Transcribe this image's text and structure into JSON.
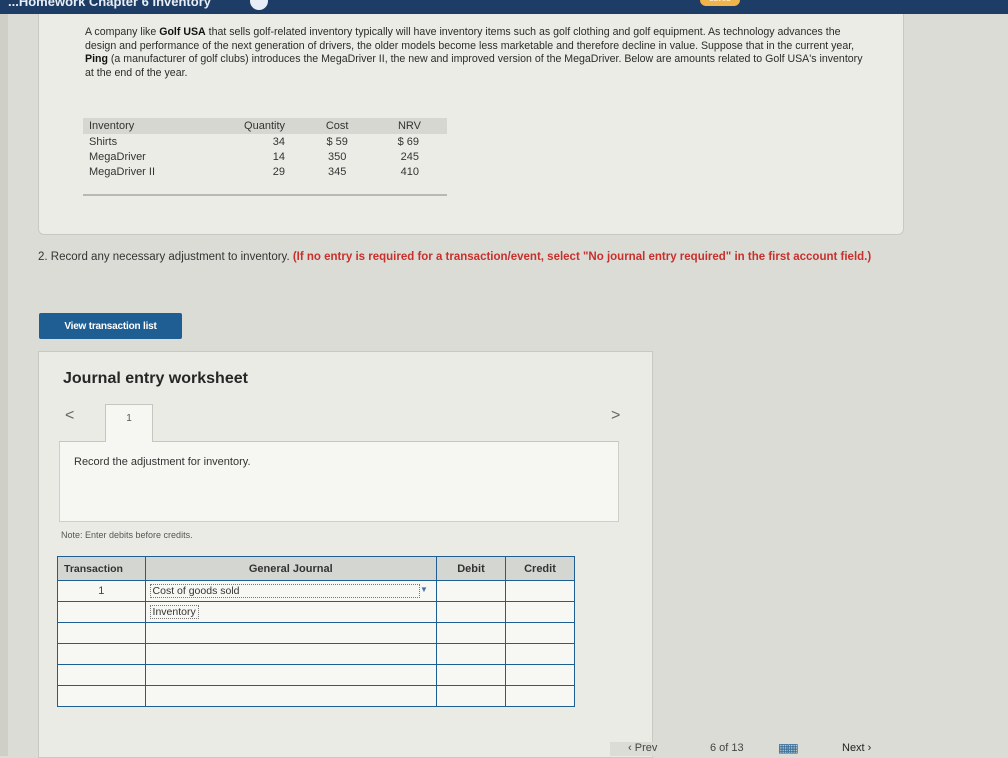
{
  "header": {
    "title": "...Homework Chapter 6 Inventory",
    "saved_badge": "saved"
  },
  "problem": {
    "intro_1": "A company like ",
    "company": "Golf USA",
    "intro_2": " that sells golf-related inventory typically will have inventory items such as golf clothing and golf equipment. As technology advances the design and performance of the next generation of drivers, the older models become less marketable and therefore decline in value. Suppose that in the current year, ",
    "manufacturer": "Ping",
    "intro_3": " (a manufacturer of golf clubs) introduces the MegaDriver II, the new and improved version of the MegaDriver. Below are amounts related to Golf USA's inventory at the end of the year."
  },
  "inventory_table": {
    "headers": [
      "Inventory",
      "Quantity",
      "Cost",
      "NRV"
    ],
    "rows": [
      [
        "Shirts",
        "34",
        "$ 59",
        "$ 69"
      ],
      [
        "MegaDriver",
        "14",
        "350",
        "245"
      ],
      [
        "MegaDriver II",
        "29",
        "345",
        "410"
      ]
    ]
  },
  "question": {
    "text": "2. Record any necessary adjustment to inventory. ",
    "instruction": "(If no entry is required for a transaction/event, select \"No journal entry required\" in the first account field.)"
  },
  "buttons": {
    "view_transaction_list": "View transaction list"
  },
  "worksheet": {
    "title": "Journal entry worksheet",
    "nav_prev": "<",
    "nav_next": ">",
    "tab_label": "1",
    "record_text": "Record the adjustment for inventory.",
    "note": "Note: Enter debits before credits.",
    "columns": [
      "Transaction",
      "General Journal",
      "Debit",
      "Credit"
    ],
    "rows": [
      {
        "transaction": "1",
        "account": "Cost of goods sold",
        "debit": "",
        "credit": ""
      },
      {
        "transaction": "",
        "account": "Inventory",
        "debit": "",
        "credit": ""
      },
      {
        "transaction": "",
        "account": "",
        "debit": "",
        "credit": ""
      },
      {
        "transaction": "",
        "account": "",
        "debit": "",
        "credit": ""
      },
      {
        "transaction": "",
        "account": "",
        "debit": "",
        "credit": ""
      },
      {
        "transaction": "",
        "account": "",
        "debit": "",
        "credit": ""
      }
    ]
  },
  "footer": {
    "prev": "Prev",
    "page": "6 of 13",
    "next": "Next"
  }
}
